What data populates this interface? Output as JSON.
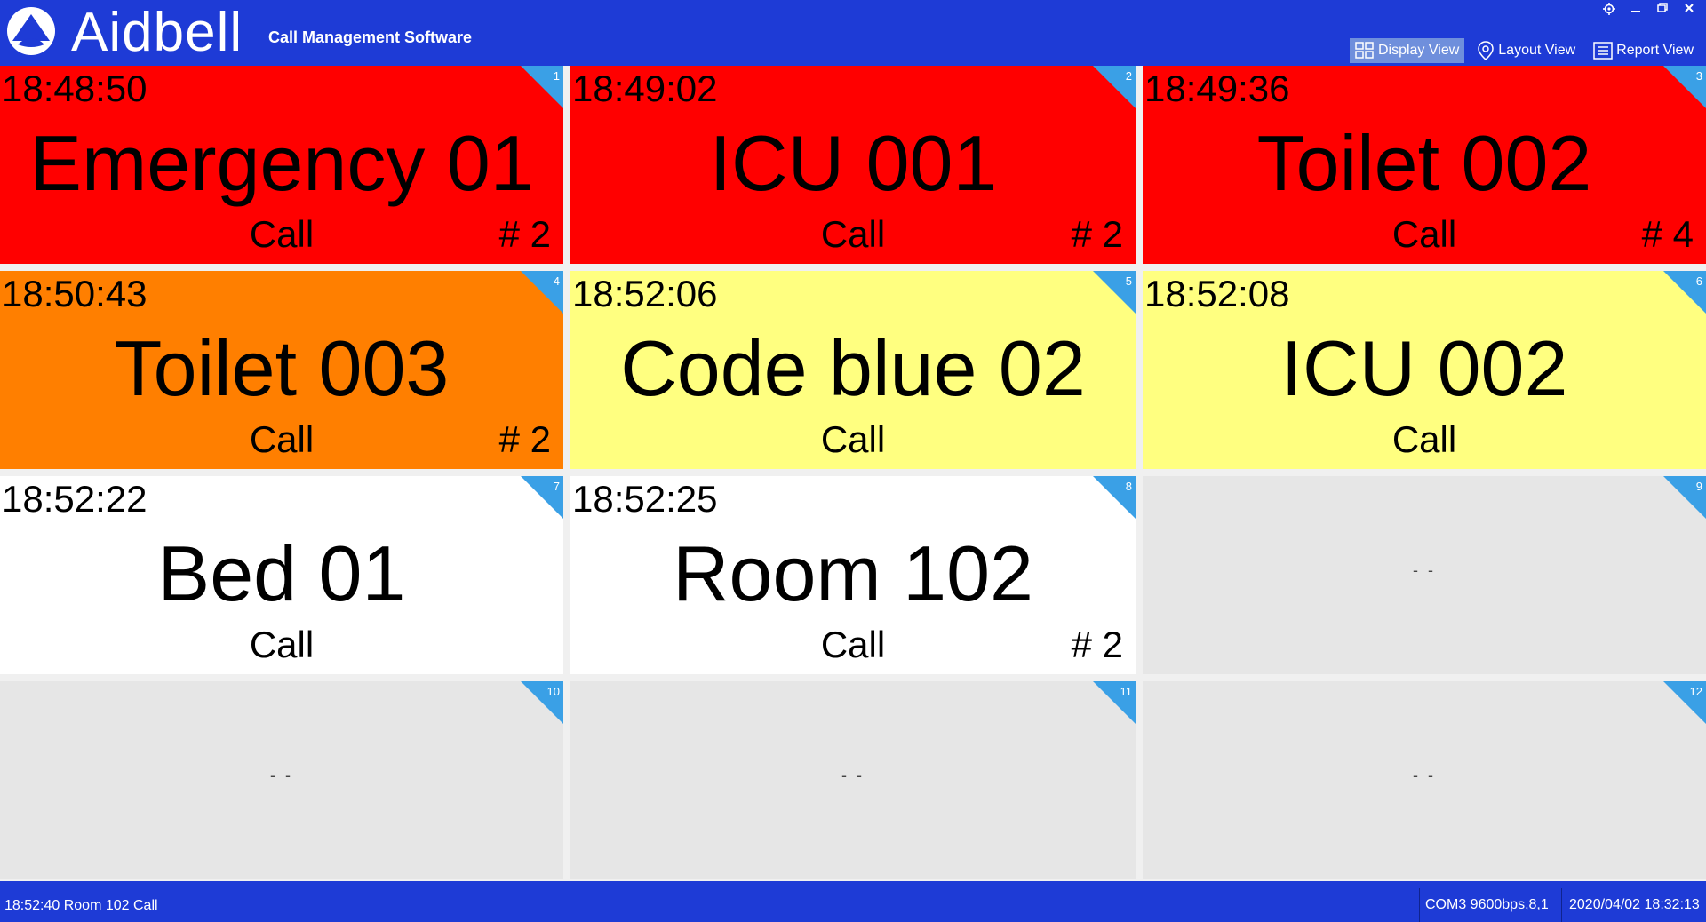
{
  "header": {
    "brand": "Aidbell",
    "subtitle": "Call Management Software",
    "nav": [
      {
        "label": "Display View",
        "icon": "grid-icon",
        "active": true
      },
      {
        "label": "Layout View",
        "icon": "location-pin-icon",
        "active": false
      },
      {
        "label": "Report View",
        "icon": "list-icon",
        "active": false
      }
    ]
  },
  "colors": {
    "header_bg": "#1e3bd6",
    "emergency": "#ff0000",
    "urgent": "#ff7f00",
    "warning": "#ffff80",
    "normal": "#ffffff",
    "idle": "#e6e6e6",
    "corner": "#3aa0e6"
  },
  "tiles": [
    {
      "num": "1",
      "time": "18:48:50",
      "name": "Emergency 01",
      "status": "Call",
      "count": "# 2",
      "state": "emergency"
    },
    {
      "num": "2",
      "time": "18:49:02",
      "name": "ICU 001",
      "status": "Call",
      "count": "# 2",
      "state": "emergency"
    },
    {
      "num": "3",
      "time": "18:49:36",
      "name": "Toilet 002",
      "status": "Call",
      "count": "# 4",
      "state": "emergency"
    },
    {
      "num": "4",
      "time": "18:50:43",
      "name": "Toilet 003",
      "status": "Call",
      "count": "# 2",
      "state": "urgent"
    },
    {
      "num": "5",
      "time": "18:52:06",
      "name": "Code blue 02",
      "status": "Call",
      "count": "",
      "state": "warning"
    },
    {
      "num": "6",
      "time": "18:52:08",
      "name": "ICU 002",
      "status": "Call",
      "count": "",
      "state": "warning"
    },
    {
      "num": "7",
      "time": "18:52:22",
      "name": "Bed 01",
      "status": "Call",
      "count": "",
      "state": "normal"
    },
    {
      "num": "8",
      "time": "18:52:25",
      "name": "Room 102",
      "status": "Call",
      "count": "# 2",
      "state": "normal"
    },
    {
      "num": "9",
      "time": "",
      "name": "",
      "status": "",
      "count": "",
      "state": "idle",
      "empty": "- -"
    },
    {
      "num": "10",
      "time": "",
      "name": "",
      "status": "",
      "count": "",
      "state": "idle",
      "empty": "- -"
    },
    {
      "num": "11",
      "time": "",
      "name": "",
      "status": "",
      "count": "",
      "state": "idle",
      "empty": "- -"
    },
    {
      "num": "12",
      "time": "",
      "name": "",
      "status": "",
      "count": "",
      "state": "idle",
      "empty": "- -"
    }
  ],
  "statusbar": {
    "last_event": "18:52:40  Room 102 Call",
    "port": "COM3 9600bps,8,1",
    "datetime": "2020/04/02 18:32:13"
  }
}
